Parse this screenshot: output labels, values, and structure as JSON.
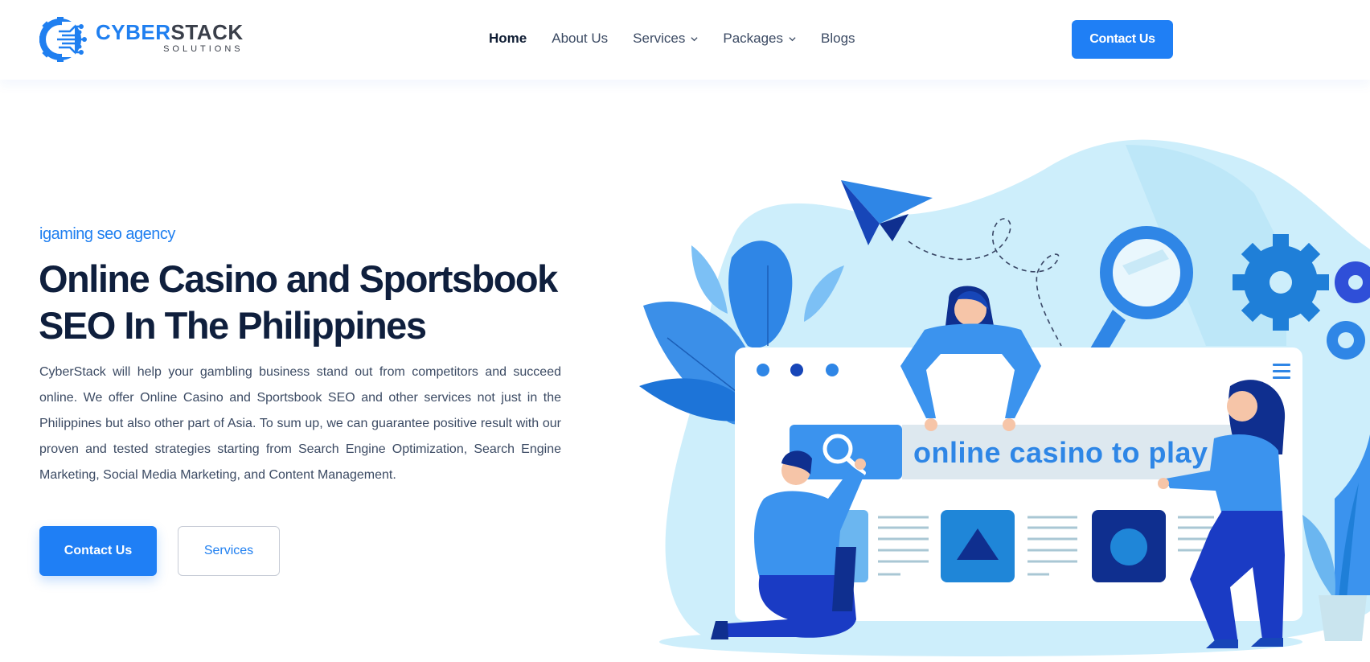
{
  "brand": {
    "name_part1": "CYBER",
    "name_part2": "STACK",
    "subtitle": "SOLUTIONS"
  },
  "nav": {
    "items": [
      {
        "label": "Home",
        "active": true,
        "dropdown": false
      },
      {
        "label": "About Us",
        "active": false,
        "dropdown": false
      },
      {
        "label": "Services",
        "active": false,
        "dropdown": true
      },
      {
        "label": "Packages",
        "active": false,
        "dropdown": true
      },
      {
        "label": "Blogs",
        "active": false,
        "dropdown": false
      }
    ],
    "cta_label": "Contact Us"
  },
  "hero": {
    "eyebrow": "igaming seo agency",
    "title": "Online Casino and Sportsbook SEO In The Philippines",
    "description": "CyberStack will help your gambling business stand out from competitors and succeed online. We offer Online Casino and Sportsbook SEO and other services not just in the Philippines but also other part of Asia. To sum up, we can guarantee positive result with our proven and tested strategies starting from Search Engine Optimization, Search Engine Marketing, Social Media Marketing, and Content Management.",
    "primary_button": "Contact Us",
    "secondary_button": "Services"
  },
  "illustration": {
    "search_text": "online casino to play"
  },
  "colors": {
    "accent": "#1f7ff5",
    "heading": "#0f1f3d",
    "body_text": "#3b4a63",
    "light_blue": "#cfeefb"
  }
}
